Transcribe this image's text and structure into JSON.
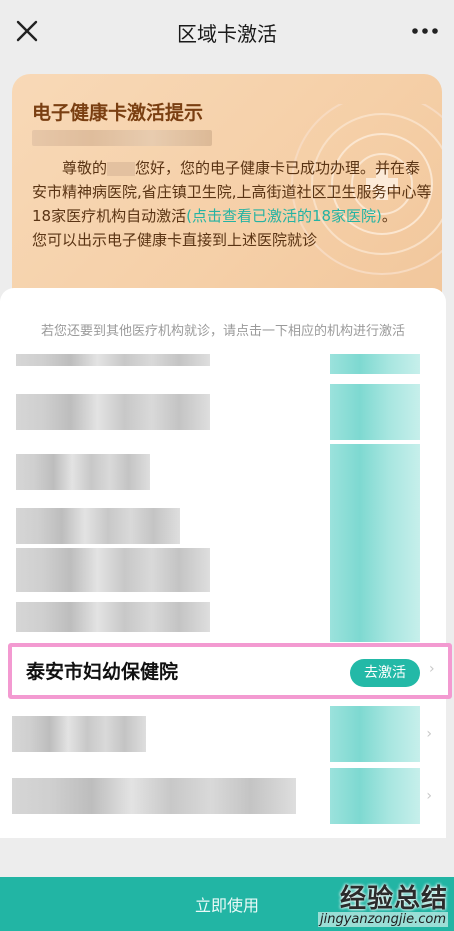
{
  "navbar": {
    "title": "区域卡激活",
    "close_icon": "close-icon",
    "more_icon": "more-dots-icon"
  },
  "notice": {
    "title": "电子健康卡激活提示",
    "greeting_prefix": "尊敬的",
    "greeting_suffix": "您好，您的电子健康卡已成功办理。并在泰安市精神病医院,省庄镇卫生院,上高街道社区卫生服务中心等18家医疗机构自动激活",
    "link_text": "(点击查看已激活的18家医院)",
    "link_end": "。",
    "line2": "您可以出示电子健康卡直接到上述医院就诊",
    "colors": {
      "bg": "#f5cfa7",
      "title": "#7a3f12",
      "link": "#25b3a3"
    }
  },
  "hint": "若您还要到其他医疗机构就诊，请点击一下相应的机构进行激活",
  "highlighted_row": {
    "name": "泰安市妇幼保健院",
    "button": "去激活",
    "chevron": "›"
  },
  "bottom_bar": {
    "label": "立即使用",
    "color": "#22b5a4"
  },
  "watermark": {
    "cn": "经验总结",
    "url": "jingyanzongjie.com"
  }
}
